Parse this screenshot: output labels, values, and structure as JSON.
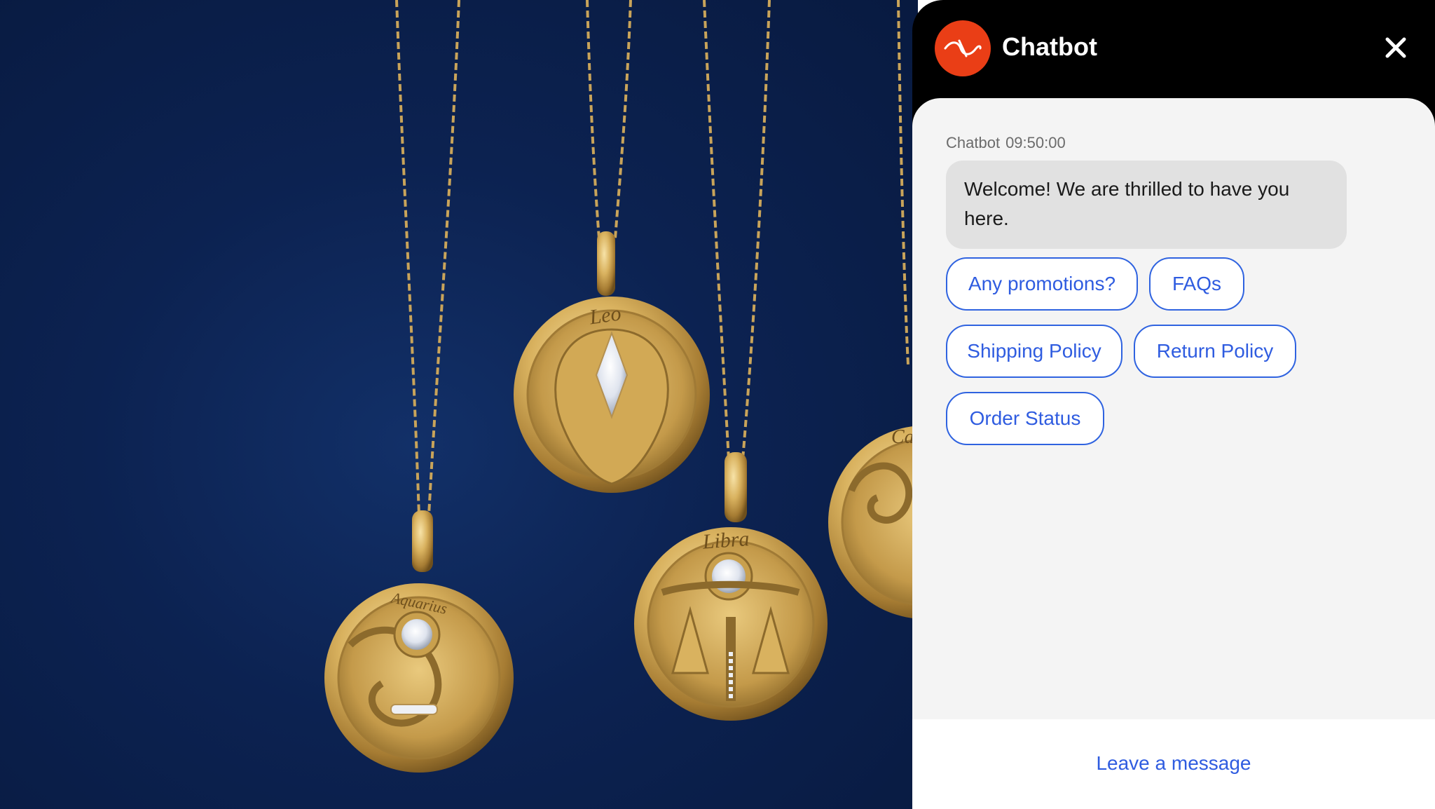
{
  "hero": {
    "pendant_engravings": [
      "Leo",
      "Libra",
      "Aquarius",
      "Ca"
    ]
  },
  "chat": {
    "title": "Chatbot",
    "brand_color": "#ea3e16",
    "accent_color": "#2f5ce0",
    "header_icon": "brand-logo-icon",
    "close_icon": "close-icon",
    "message": {
      "sender": "Chatbot",
      "time": "09:50:00",
      "text": "Welcome! We are thrilled to have you here."
    },
    "quick_replies": [
      {
        "label": "Any promotions?"
      },
      {
        "label": "FAQs"
      },
      {
        "label": "Shipping Policy"
      },
      {
        "label": "Return Policy"
      },
      {
        "label": "Order Status"
      }
    ],
    "footer": {
      "leave_message_label": "Leave a message"
    }
  }
}
